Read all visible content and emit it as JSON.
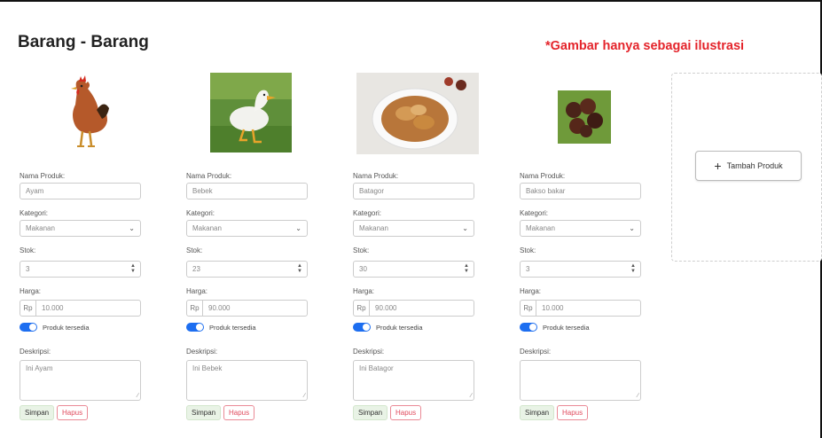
{
  "header": {
    "title": "Barang - Barang",
    "note": "*Gambar hanya sebagai ilustrasi"
  },
  "labels": {
    "name": "Nama Produk:",
    "category": "Kategori:",
    "stock": "Stok:",
    "price": "Harga:",
    "currency": "Rp",
    "available": "Produk tersedia",
    "description": "Deskripsi:",
    "save": "Simpan",
    "delete": "Hapus"
  },
  "products": [
    {
      "name": "Ayam",
      "category": "Makanan",
      "stock": "3",
      "price": "10.000",
      "available": true,
      "description": "Ini Ayam",
      "image": "chicken-photo"
    },
    {
      "name": "Bebek",
      "category": "Makanan",
      "stock": "23",
      "price": "90.000",
      "available": true,
      "description": "Ini Bebek",
      "image": "duck-photo"
    },
    {
      "name": "Batagor",
      "category": "Makanan",
      "stock": "30",
      "price": "90.000",
      "available": true,
      "description": "Ini Batagor",
      "image": "batagor-photo"
    },
    {
      "name": "Bakso bakar",
      "category": "Makanan",
      "stock": "3",
      "price": "10.000",
      "available": true,
      "description": "",
      "image": "bakso-bakar-photo"
    }
  ],
  "add_button": {
    "label": "Tambah Produk",
    "icon": "plus-icon"
  },
  "colors": {
    "note": "#e4242b",
    "toggle": "#1d6ef0",
    "delete": "#e04a5c",
    "save_bg": "#e9f3e6"
  }
}
